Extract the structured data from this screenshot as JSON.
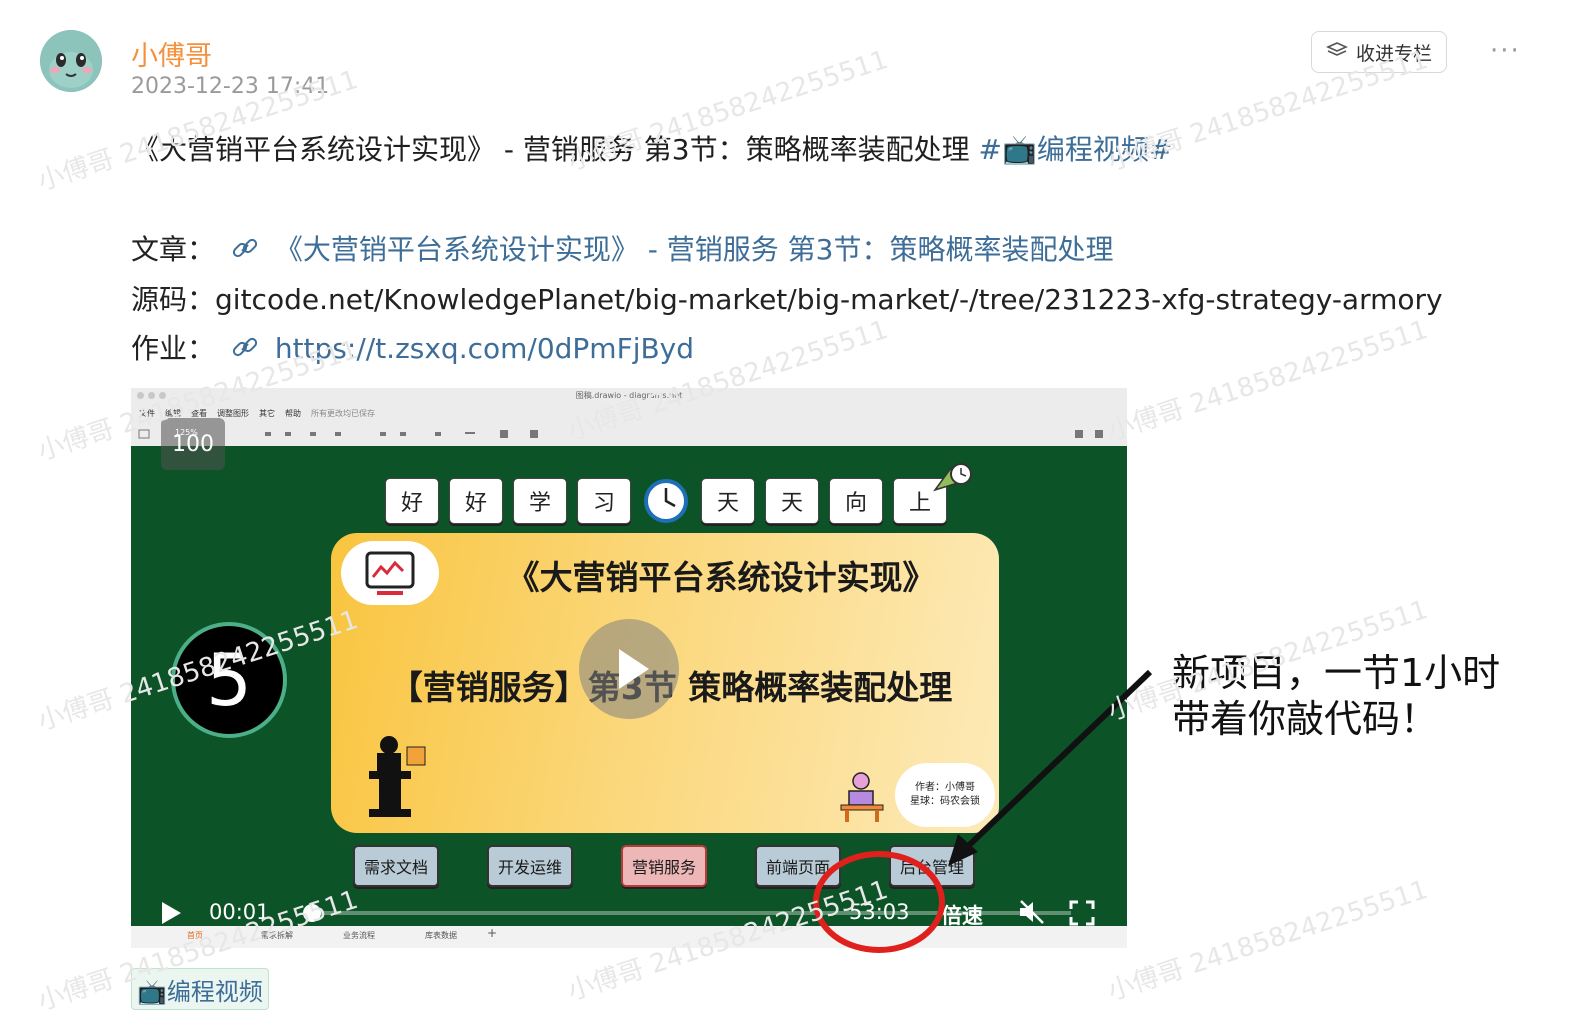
{
  "header": {
    "author": "小傅哥",
    "post_time": "2023-12-23 17:41",
    "collect_label": "收进专栏",
    "more_label": "···"
  },
  "post": {
    "title_prefix": "《大营销平台系统设计实现》 - 营销服务 第3节：策略概率装配处理 ",
    "hashtag": "#📺编程视频#",
    "article_label": "文章：",
    "article_link": "《大营销平台系统设计实现》 - 营销服务 第3节：策略概率装配处理",
    "source_label": "源码：",
    "source_value": "gitcode.net/KnowledgePlanet/big-market/big-market/-/tree/231223-xfg-strategy-armory",
    "homework_label": "作业：",
    "homework_link": "https://t.zsxq.com/0dPmFjByd"
  },
  "video": {
    "window_title": "图稿.drawio - diagrams.net",
    "menu": [
      "文件",
      "编辑",
      "查看",
      "调整图形",
      "其它",
      "帮助",
      "所有更改均已保存"
    ],
    "zoom_value": "100",
    "zoom_small": "125%",
    "tiles": [
      "好",
      "好",
      "学",
      "习",
      "天",
      "天",
      "向",
      "上"
    ],
    "card_title": "《大营销平台系统设计实现》",
    "card_sub": "【营销服务】第3节 策略概率装配处理",
    "author_line1": "作者：小傅哥",
    "author_line2": "星球：码农会锁",
    "big_number": "5",
    "bottom_tabs": [
      "需求文档",
      "开发运维",
      "营销服务",
      "前端页面",
      "后台管理"
    ],
    "active_tab": "营销服务",
    "current_time": "00:01",
    "duration": "53:03",
    "speed_label": "倍速",
    "progress": 0.0003,
    "sheet_tabs": [
      "首页",
      "需求拆解",
      "业务流程",
      "库表数据"
    ]
  },
  "annotation": {
    "line1": "新项目，一节1小时",
    "line2": "带着你敲代码！"
  },
  "topic": {
    "label": "📺编程视频"
  },
  "watermark": "小傅哥 2418582422555​11",
  "colors": {
    "author": "#f5913d",
    "link": "#3e6e98",
    "board_green": "#0c5427",
    "highlight_red": "#e0201c"
  }
}
